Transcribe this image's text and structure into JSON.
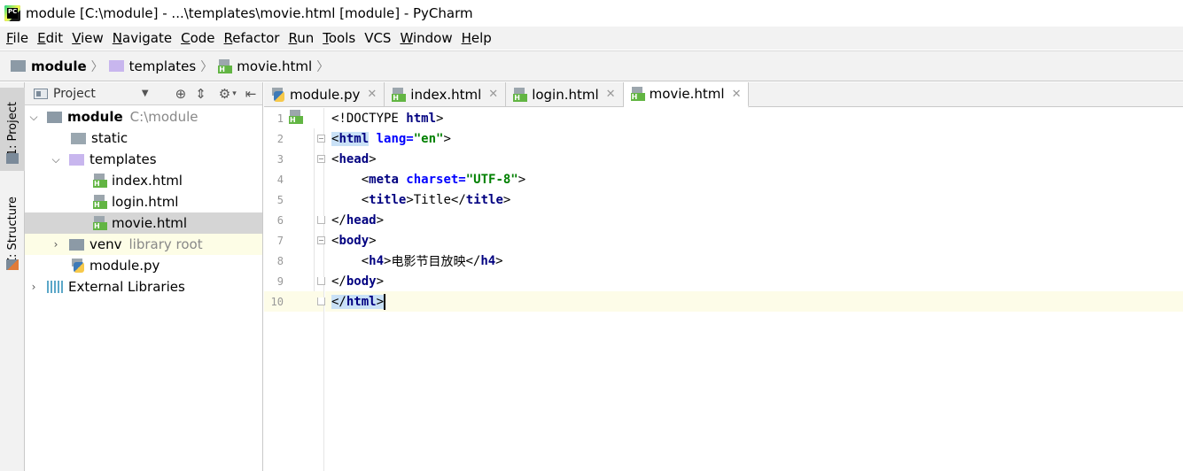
{
  "window": {
    "title": "module [C:\\module] - ...\\templates\\movie.html [module] - PyCharm",
    "logo_text": "PC"
  },
  "menu": [
    {
      "label": "File",
      "mnemonic": "F",
      "rest": "ile"
    },
    {
      "label": "Edit",
      "mnemonic": "E",
      "rest": "dit"
    },
    {
      "label": "View",
      "mnemonic": "V",
      "rest": "iew"
    },
    {
      "label": "Navigate",
      "mnemonic": "N",
      "rest": "avigate"
    },
    {
      "label": "Code",
      "mnemonic": "C",
      "rest": "ode"
    },
    {
      "label": "Refactor",
      "mnemonic": "R",
      "rest": "efactor"
    },
    {
      "label": "Run",
      "mnemonic": "R",
      "rest": "un",
      "prefix": ""
    },
    {
      "label": "Tools",
      "mnemonic": "T",
      "rest": "ools"
    },
    {
      "label": "VCS",
      "mnemonic": "",
      "rest": "VCS"
    },
    {
      "label": "Window",
      "mnemonic": "W",
      "rest": "indow"
    },
    {
      "label": "Help",
      "mnemonic": "H",
      "rest": "elp"
    }
  ],
  "breadcrumb": {
    "root": "module",
    "folder": "templates",
    "file": "movie.html"
  },
  "toolstripe": {
    "project_tab": "1: Project",
    "structure_tab": "Z: Structure"
  },
  "project_panel": {
    "header_label": "Project",
    "tree": {
      "root_name": "module",
      "root_path": "C:\\module",
      "static": "static",
      "templates": "templates",
      "index": "index.html",
      "login": "login.html",
      "movie": "movie.html",
      "venv": "venv",
      "venv_note": "library root",
      "module_py": "module.py",
      "external": "External Libraries"
    }
  },
  "tabs": [
    {
      "label": "module.py",
      "type": "py"
    },
    {
      "label": "index.html",
      "type": "html"
    },
    {
      "label": "login.html",
      "type": "html"
    },
    {
      "label": "movie.html",
      "type": "html",
      "active": true
    }
  ],
  "editor": {
    "line_numbers": [
      "1",
      "2",
      "3",
      "4",
      "5",
      "6",
      "7",
      "8",
      "9",
      "10"
    ],
    "code": {
      "l1_open": "<!DOCTYPE ",
      "l1_tag": "html",
      "l1_close": ">",
      "l2_open": "<",
      "l2_tag": "html",
      "l2_attr": " lang=",
      "l2_val": "\"en\"",
      "l2_close": ">",
      "l3_open": "<",
      "l3_tag": "head",
      "l3_close": ">",
      "l4_indent": "    ",
      "l4_open": "<",
      "l4_tag": "meta",
      "l4_attr": " charset=",
      "l4_val": "\"UTF-8\"",
      "l4_close": ">",
      "l5_indent": "    ",
      "l5_open": "<",
      "l5_tag": "title",
      "l5_close": ">",
      "l5_text": "Title",
      "l5_end_open": "</",
      "l5_end_tag": "title",
      "l5_end_close": ">",
      "l6_open": "</",
      "l6_tag": "head",
      "l6_close": ">",
      "l7_open": "<",
      "l7_tag": "body",
      "l7_close": ">",
      "l8_indent": "    ",
      "l8_open": "<",
      "l8_tag": "h4",
      "l8_close": ">",
      "l8_text": "电影节目放映",
      "l8_end_open": "</",
      "l8_end_tag": "h4",
      "l8_end_close": ">",
      "l9_open": "</",
      "l9_tag": "body",
      "l9_close": ">",
      "l10_open": "</",
      "l10_tag": "html",
      "l10_close": ">"
    }
  }
}
